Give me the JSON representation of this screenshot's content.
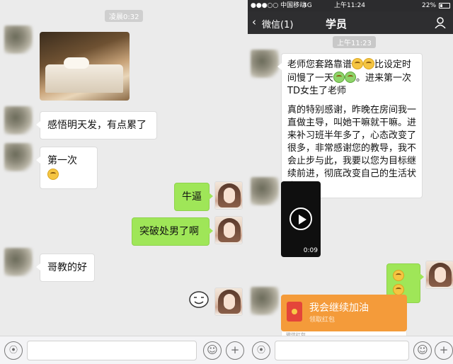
{
  "left": {
    "timestamp": "凌晨0:32",
    "messages": [
      {
        "side": "in",
        "type": "image"
      },
      {
        "side": "in",
        "text": "感悟明天发，有点累了"
      },
      {
        "side": "in",
        "text": "第一次"
      },
      {
        "side": "out",
        "text": "牛逼"
      },
      {
        "side": "out",
        "text": "突破处男了啊"
      },
      {
        "side": "in",
        "text": "哥教的好"
      },
      {
        "side": "out",
        "type": "sticker"
      }
    ],
    "input": {
      "voice_icon": "voice-icon",
      "emoji_icon": "emoji-icon",
      "plus": "+"
    }
  },
  "right": {
    "status": {
      "carrier": "●●●○○ 中国移动",
      "network": "4G",
      "time": "上午11:24",
      "battery": "22%"
    },
    "nav": {
      "back": "微信(1)",
      "title": "学员"
    },
    "timestamp": "上午11:23",
    "long_message": {
      "line1": "老师您套路靠谱",
      "line1b": "比设定时间慢了一天",
      "line1c": "。进来第一次TD女生了老师",
      "para2": "真的特别感谢，昨晚在房间我一直做主导，叫她干嘛就干嘛。进来补习班半年多了，心态改变了很多，非常感谢您的教导，我不会止步与此，我要以您为目标继续前进，彻底改变自己的生活状态。"
    },
    "video": {
      "duration": "0:09"
    },
    "red_packet": {
      "title": "我会继续加油",
      "subtitle": "领取红包",
      "footer": "微信红包"
    },
    "input": {
      "plus": "+"
    }
  },
  "colors": {
    "chat_bg": "#ebebeb",
    "out_bubble": "#9fe658",
    "in_bubble": "#ffffff",
    "nav_bar": "#2e2e30",
    "red_packet": "#f49b3a"
  }
}
